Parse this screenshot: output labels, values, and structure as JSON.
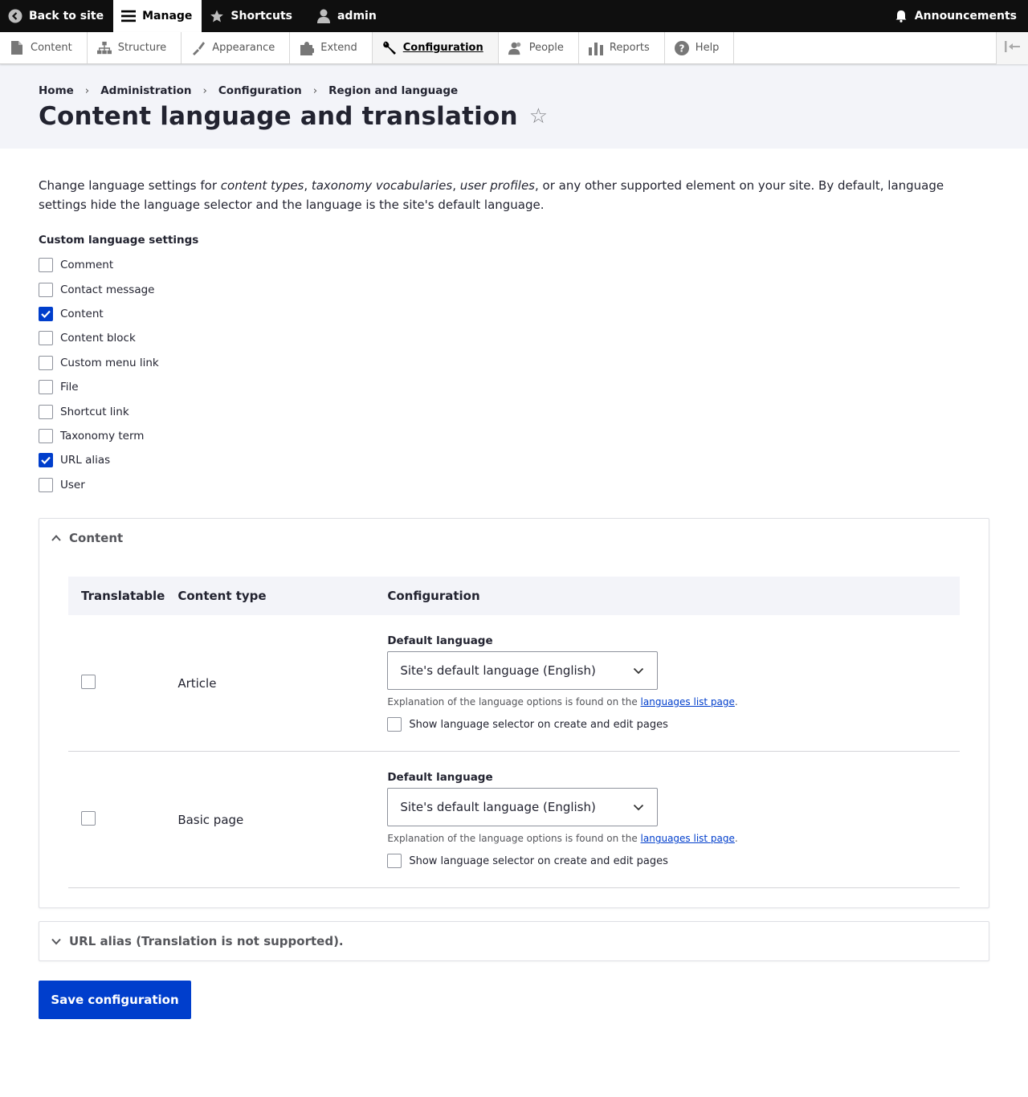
{
  "toolbar": {
    "back_label": "Back to site",
    "manage_label": "Manage",
    "shortcuts_label": "Shortcuts",
    "user_label": "admin",
    "announcements_label": "Announcements"
  },
  "tray": {
    "items": [
      {
        "label": "Content",
        "icon": "file-icon"
      },
      {
        "label": "Structure",
        "icon": "sitemap-icon"
      },
      {
        "label": "Appearance",
        "icon": "paintbrush-icon"
      },
      {
        "label": "Extend",
        "icon": "puzzle-icon"
      },
      {
        "label": "Configuration",
        "icon": "wrench-icon"
      },
      {
        "label": "People",
        "icon": "people-icon"
      },
      {
        "label": "Reports",
        "icon": "bar-chart-icon"
      },
      {
        "label": "Help",
        "icon": "help-icon"
      }
    ],
    "active": "Configuration"
  },
  "breadcrumb": [
    "Home",
    "Administration",
    "Configuration",
    "Region and language"
  ],
  "page_title": "Content language and translation",
  "intro": {
    "part1": "Change language settings for ",
    "em1": "content types",
    "part2": ", ",
    "em2": "taxonomy vocabularies",
    "part3": ", ",
    "em3": "user profiles",
    "part4": ", or any other supported element on your site. By default, language settings hide the language selector and the language is the site's default language."
  },
  "custom_settings": {
    "label": "Custom language settings",
    "items": [
      {
        "label": "Comment",
        "checked": false
      },
      {
        "label": "Contact message",
        "checked": false
      },
      {
        "label": "Content",
        "checked": true
      },
      {
        "label": "Content block",
        "checked": false
      },
      {
        "label": "Custom menu link",
        "checked": false
      },
      {
        "label": "File",
        "checked": false
      },
      {
        "label": "Shortcut link",
        "checked": false
      },
      {
        "label": "Taxonomy term",
        "checked": false
      },
      {
        "label": "URL alias",
        "checked": true
      },
      {
        "label": "User",
        "checked": false
      }
    ]
  },
  "content_details": {
    "summary": "Content",
    "headers": {
      "translatable": "Translatable",
      "content_type": "Content type",
      "configuration": "Configuration"
    },
    "rows": [
      {
        "content_type": "Article",
        "translatable": false,
        "default_language_label": "Default language",
        "select_value": "Site's default language (English)",
        "desc_text": "Explanation of the language options is found on the ",
        "desc_link": "languages list page",
        "desc_end": ".",
        "show_selector_label": "Show language selector on create and edit pages",
        "show_selector_checked": false
      },
      {
        "content_type": "Basic page",
        "translatable": false,
        "default_language_label": "Default language",
        "select_value": "Site's default language (English)",
        "desc_text": "Explanation of the language options is found on the ",
        "desc_link": "languages list page",
        "desc_end": ".",
        "show_selector_label": "Show language selector on create and edit pages",
        "show_selector_checked": false
      }
    ]
  },
  "url_alias_details": {
    "summary": "URL alias (Translation is not supported)."
  },
  "save_button": "Save configuration",
  "colors": {
    "accent": "#003ecc",
    "toolbar_bg": "#0f0f0f",
    "header_bg": "#f3f4f9"
  }
}
